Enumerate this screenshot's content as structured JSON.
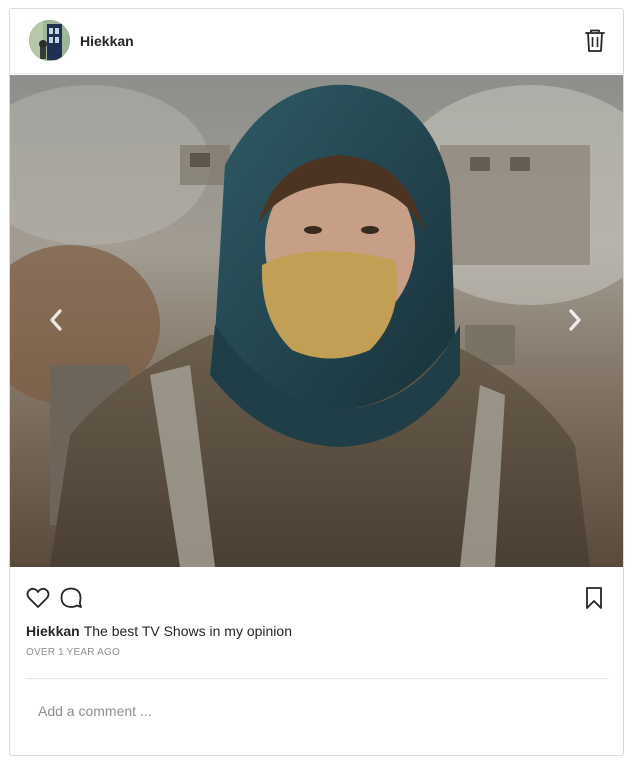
{
  "post": {
    "username": "Hiekkan",
    "caption_user": "Hiekkan",
    "caption_text": "The best TV Shows in my opinion",
    "timestamp": "OVER 1 YEAR AGO"
  },
  "comment_box": {
    "placeholder": "Add a comment ..."
  },
  "icons": {
    "delete": "trash-icon",
    "prev": "chevron-left-icon",
    "next": "chevron-right-icon",
    "like": "heart-icon",
    "comment": "speech-bubble-icon",
    "save": "bookmark-icon"
  },
  "colors": {
    "text": "#262626",
    "muted": "#8e8e8e",
    "border": "#dbdbdb"
  }
}
